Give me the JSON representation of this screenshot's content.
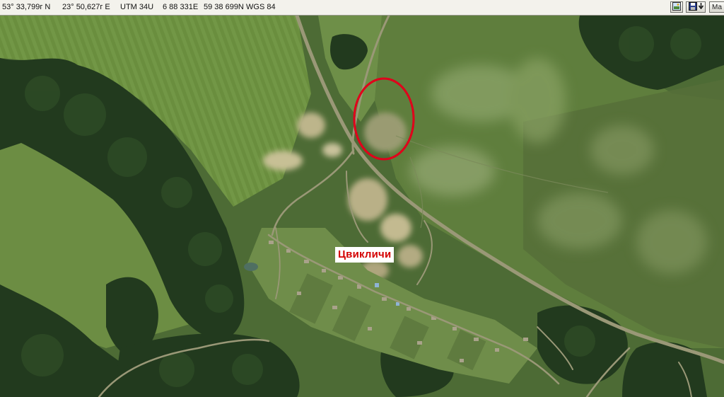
{
  "statusbar": {
    "lat": "53° 33,799г N",
    "lon": "23° 50,627г E",
    "utm": "UTM  34U",
    "easting": "6 88 331E",
    "northing": "59 38 699N",
    "datum": "WGS 84",
    "button_map": "Ма"
  },
  "map": {
    "place_label": "Цвикличи",
    "marker_color": "#e0001b",
    "label_color": "#d40000"
  }
}
